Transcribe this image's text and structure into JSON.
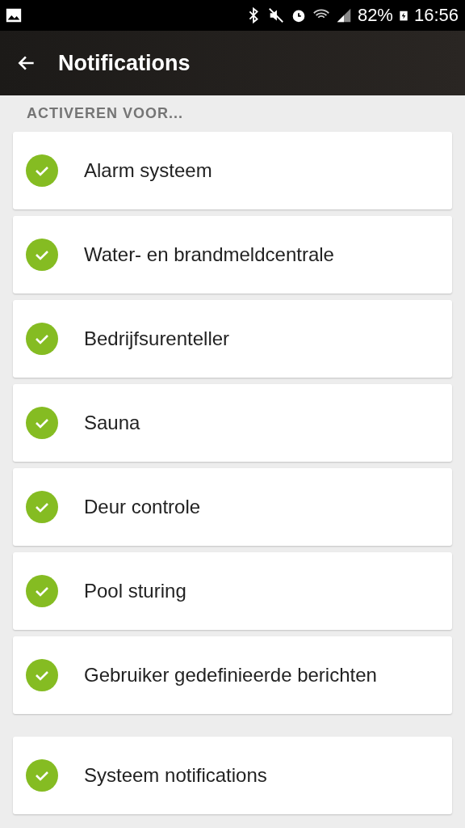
{
  "status_bar": {
    "battery": "82%",
    "time": "16:56"
  },
  "app_bar": {
    "title": "Notifications"
  },
  "section_header": "ACTIVEREN VOOR...",
  "groups": [
    {
      "items": [
        {
          "label": "Alarm systeem",
          "checked": true
        },
        {
          "label": "Water- en brandmeldcentrale",
          "checked": true
        },
        {
          "label": "Bedrijfsurenteller",
          "checked": true
        },
        {
          "label": "Sauna",
          "checked": true
        },
        {
          "label": "Deur controle",
          "checked": true
        },
        {
          "label": "Pool sturing",
          "checked": true
        },
        {
          "label": "Gebruiker gedefinieerde berichten",
          "checked": true
        }
      ]
    },
    {
      "items": [
        {
          "label": "Systeem notifications",
          "checked": true
        }
      ]
    }
  ]
}
